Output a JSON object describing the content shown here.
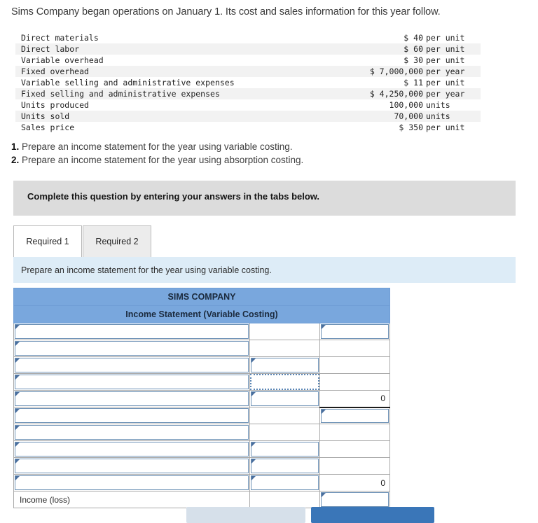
{
  "problem": {
    "intro": "Sims Company began operations on January 1. Its cost and sales information for this year follow."
  },
  "facts": {
    "rows": [
      {
        "label": "Direct materials",
        "amount": "$ 40",
        "unit": "per unit"
      },
      {
        "label": "Direct labor",
        "amount": "$ 60",
        "unit": "per unit"
      },
      {
        "label": "Variable overhead",
        "amount": "$ 30",
        "unit": "per unit"
      },
      {
        "label": "Fixed overhead",
        "amount": "$ 7,000,000",
        "unit": "per year"
      },
      {
        "label": "Variable selling and administrative expenses",
        "amount": "$ 11",
        "unit": "per unit"
      },
      {
        "label": "Fixed selling and administrative expenses",
        "amount": "$ 4,250,000",
        "unit": "per year"
      },
      {
        "label": "Units produced",
        "amount": "100,000",
        "unit": "units"
      },
      {
        "label": "Units sold",
        "amount": "70,000",
        "unit": "units"
      },
      {
        "label": "Sales price",
        "amount": "$ 350",
        "unit": "per unit"
      }
    ]
  },
  "requirements": {
    "items": [
      {
        "num": "1.",
        "text": "Prepare an income statement for the year using variable costing."
      },
      {
        "num": "2.",
        "text": "Prepare an income statement for the year using absorption costing."
      }
    ]
  },
  "banner": {
    "text": "Complete this question by entering your answers in the tabs below."
  },
  "tabs": {
    "items": [
      {
        "label": "Required 1",
        "active": true
      },
      {
        "label": "Required 2",
        "active": false
      }
    ]
  },
  "subinstruction": {
    "text": "Prepare an income statement for the year using variable costing."
  },
  "worksheet": {
    "company": "SIMS COMPANY",
    "statement_title": "Income Statement (Variable Costing)",
    "income_loss_label": "Income (loss)",
    "values": {
      "subtotal_zero": "0",
      "total_zero": "0"
    }
  },
  "footer": {
    "prev_label": "",
    "next_label": ""
  },
  "colors": {
    "header_blue": "#79a7dd",
    "instruction_blue": "#ddecf7",
    "banner_grey": "#dcdcdc",
    "primary_button": "#3a76b8"
  }
}
